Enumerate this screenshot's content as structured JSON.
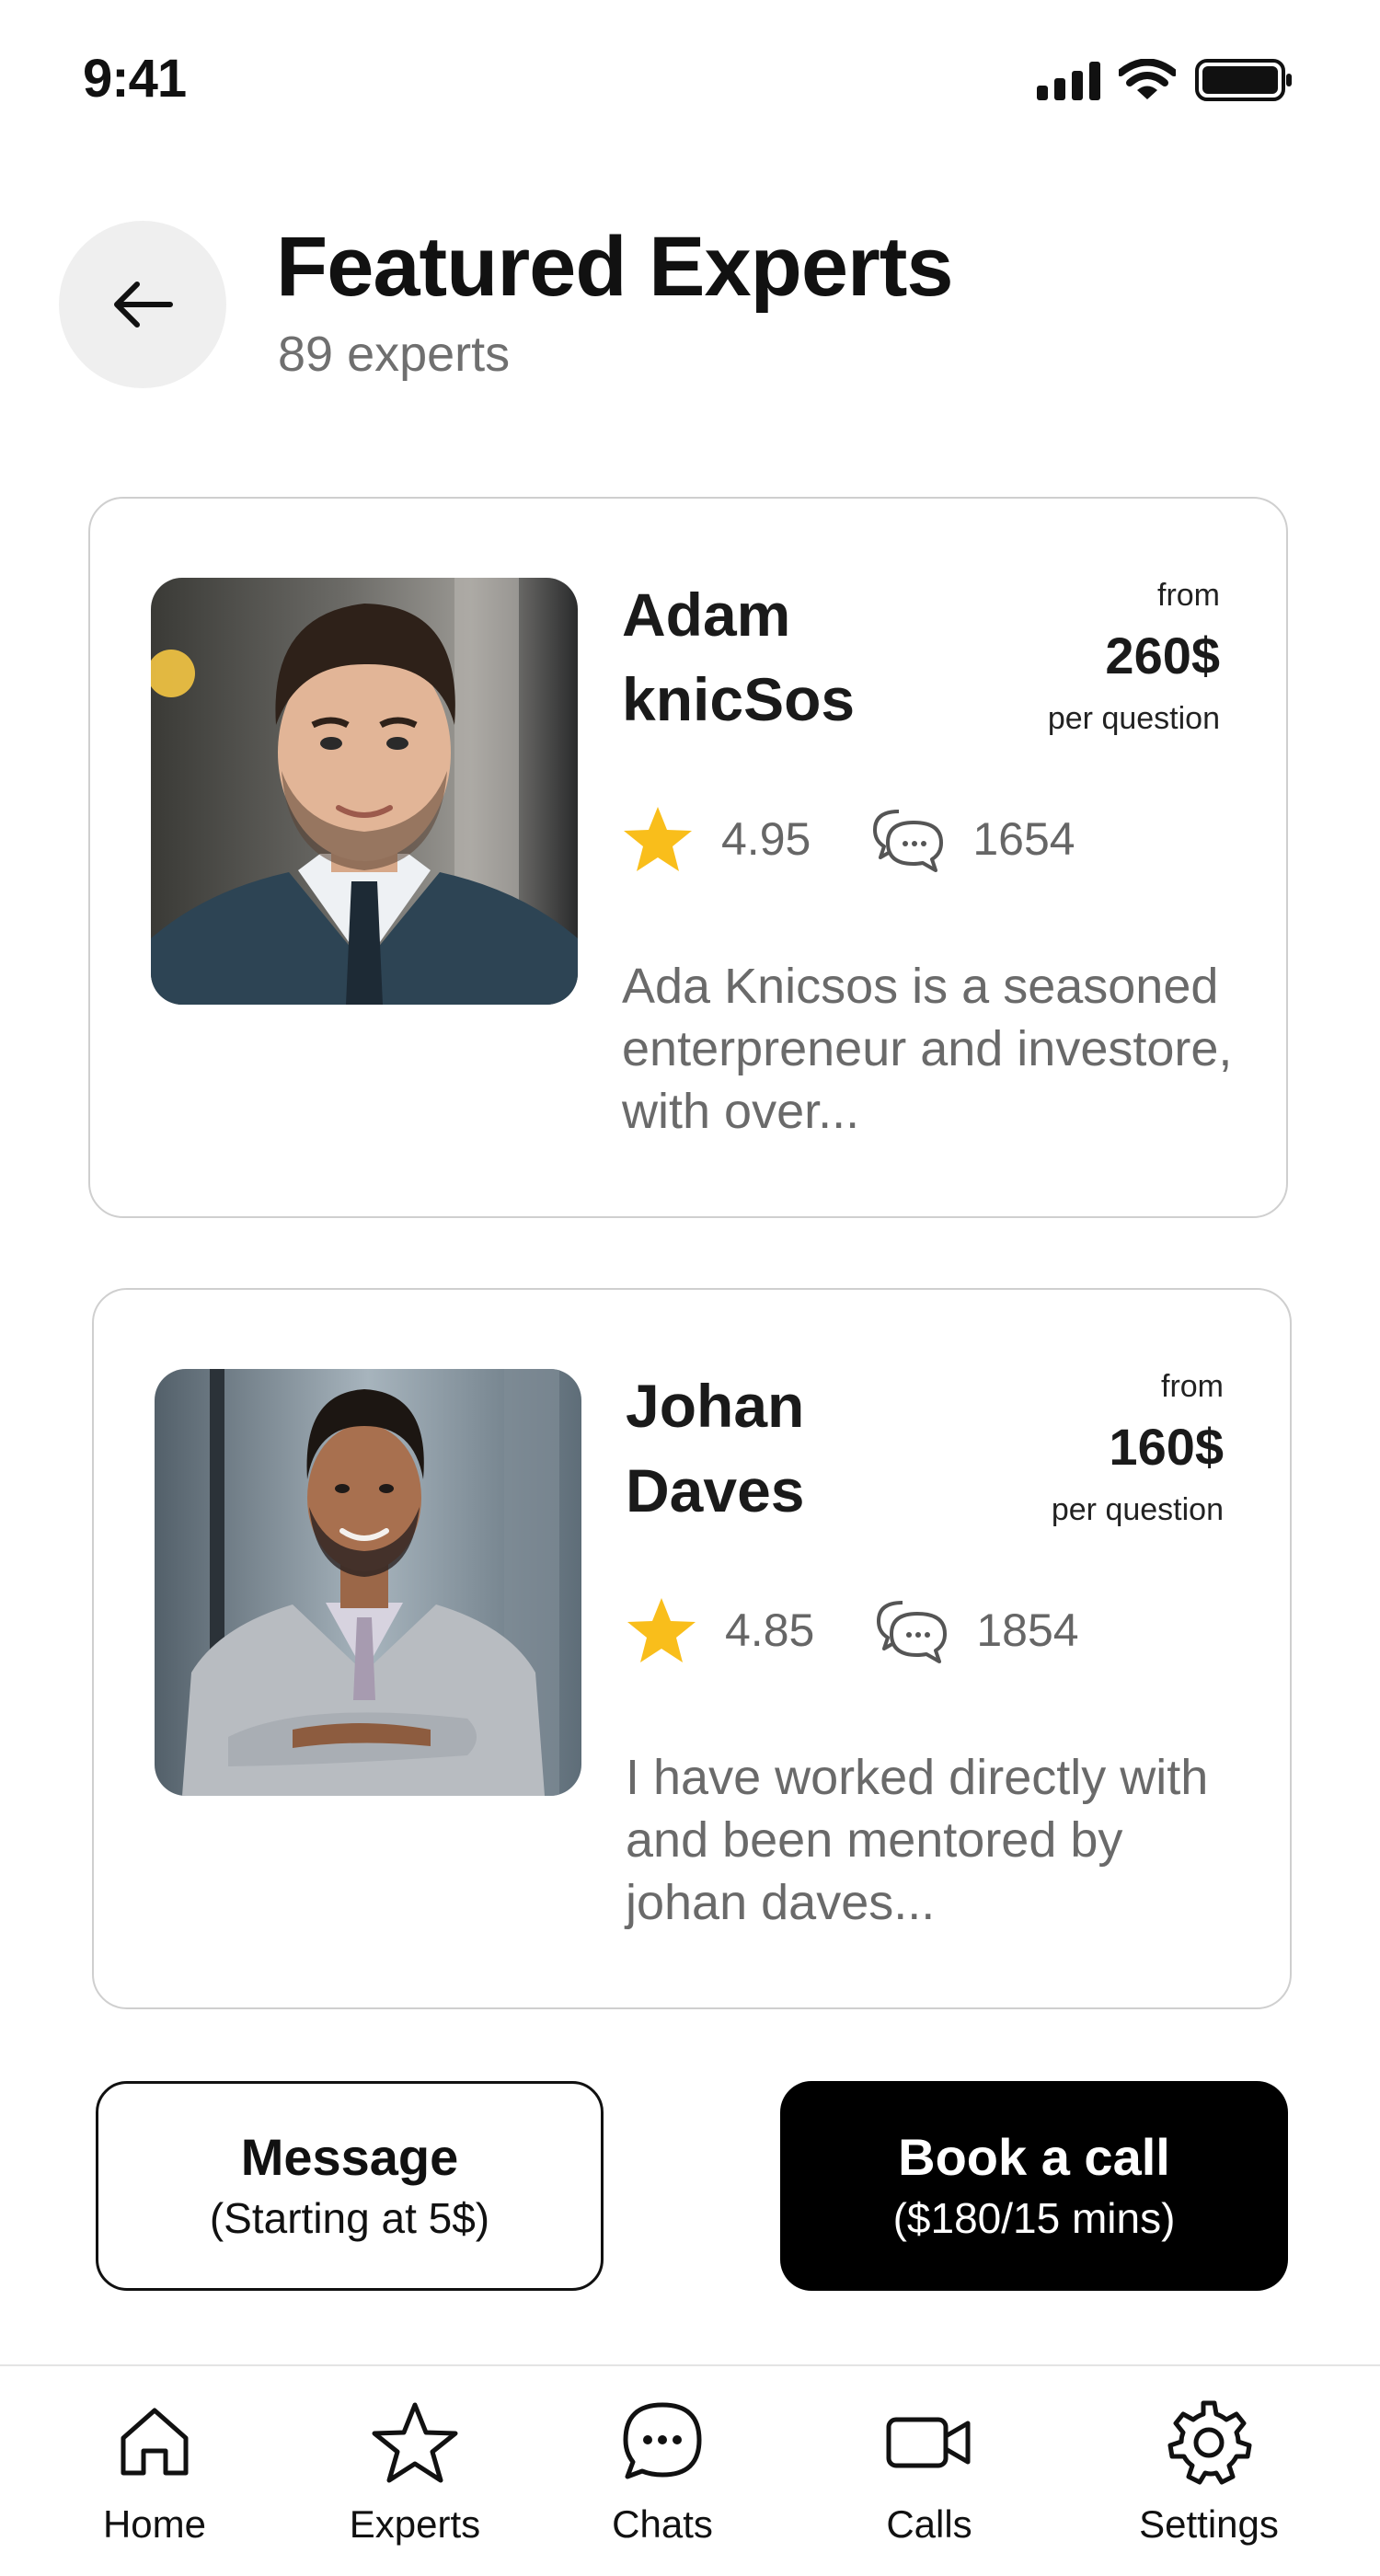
{
  "status_bar": {
    "time": "9:41"
  },
  "header": {
    "title": "Featured Experts",
    "subtitle": "89 experts"
  },
  "experts": [
    {
      "name": "Adam knicSos",
      "price_from": "from",
      "price": "260$",
      "price_unit": "per question",
      "rating": "4.95",
      "reviews": "1654",
      "description": "Ada Knicsos is a seasoned enterpreneur and investore, with over..."
    },
    {
      "name": "Johan Daves",
      "price_from": "from",
      "price": "160$",
      "price_unit": "per question",
      "rating": "4.85",
      "reviews": "1854",
      "description": "I have worked directly with and been mentored by johan daves..."
    }
  ],
  "actions": {
    "message_label": "Message",
    "message_sub": "(Starting at 5$)",
    "book_label": "Book a call",
    "book_sub": "($180/15 mins)"
  },
  "nav": {
    "items": [
      {
        "label": "Home",
        "icon": "home-icon"
      },
      {
        "label": "Experts",
        "icon": "star-icon"
      },
      {
        "label": "Chats",
        "icon": "chat-icon"
      },
      {
        "label": "Calls",
        "icon": "video-icon"
      },
      {
        "label": "Settings",
        "icon": "gear-icon"
      }
    ]
  },
  "colors": {
    "accent": "#000000",
    "star": "#F9BE1B",
    "muted_text": "#6A6A6A",
    "card_border": "#CFCFCF",
    "back_button_bg": "#EFEFEF"
  }
}
